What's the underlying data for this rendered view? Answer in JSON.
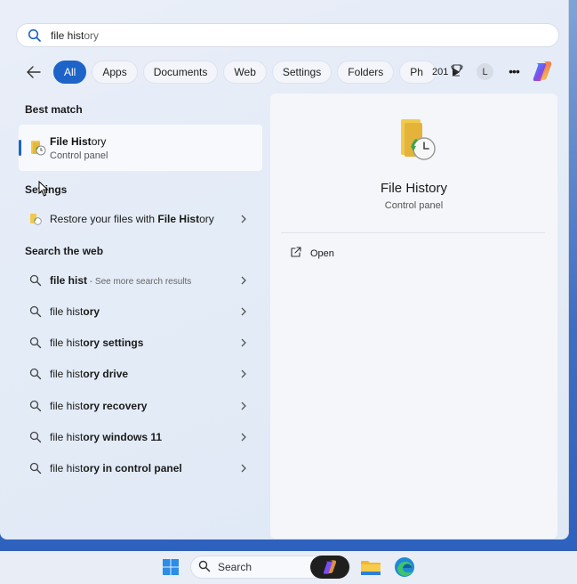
{
  "search": {
    "query_typed": "file hist",
    "query_suggested": "ory"
  },
  "filters": {
    "tabs": [
      {
        "label": "All",
        "active": true
      },
      {
        "label": "Apps",
        "active": false
      },
      {
        "label": "Documents",
        "active": false
      },
      {
        "label": "Web",
        "active": false
      },
      {
        "label": "Settings",
        "active": false
      },
      {
        "label": "Folders",
        "active": false
      },
      {
        "label": "Ph",
        "active": false
      }
    ],
    "points": "201",
    "avatar_initial": "L"
  },
  "sections": {
    "best_match": "Best match",
    "settings": "Settings",
    "web": "Search the web"
  },
  "best_match": {
    "name_bold": "File Hist",
    "name_rest": "ory",
    "subtitle": "Control panel"
  },
  "settings_item": {
    "text": "Restore your files with ",
    "bold": "File Hist",
    "rest": "ory"
  },
  "web_results": [
    {
      "bold": "file hist",
      "rest": "",
      "muted": " - See more search results"
    },
    {
      "bold": "file hist",
      "rest": "ory",
      "muted": ""
    },
    {
      "bold": "file hist",
      "rest": "ory settings",
      "muted": ""
    },
    {
      "bold": "file hist",
      "rest": "ory drive",
      "muted": ""
    },
    {
      "bold": "file hist",
      "rest": "ory recovery",
      "muted": ""
    },
    {
      "bold": "file hist",
      "rest": "ory windows 11",
      "muted": ""
    },
    {
      "bold": "file hist",
      "rest": "ory in control panel",
      "muted": ""
    }
  ],
  "preview": {
    "title": "File History",
    "subtitle": "Control panel",
    "open_label": "Open"
  },
  "taskbar": {
    "search_label": "Search"
  },
  "colors": {
    "accent": "#1e64c8",
    "folder_yellow": "#f2c94c",
    "history_green": "#3fa34d"
  }
}
